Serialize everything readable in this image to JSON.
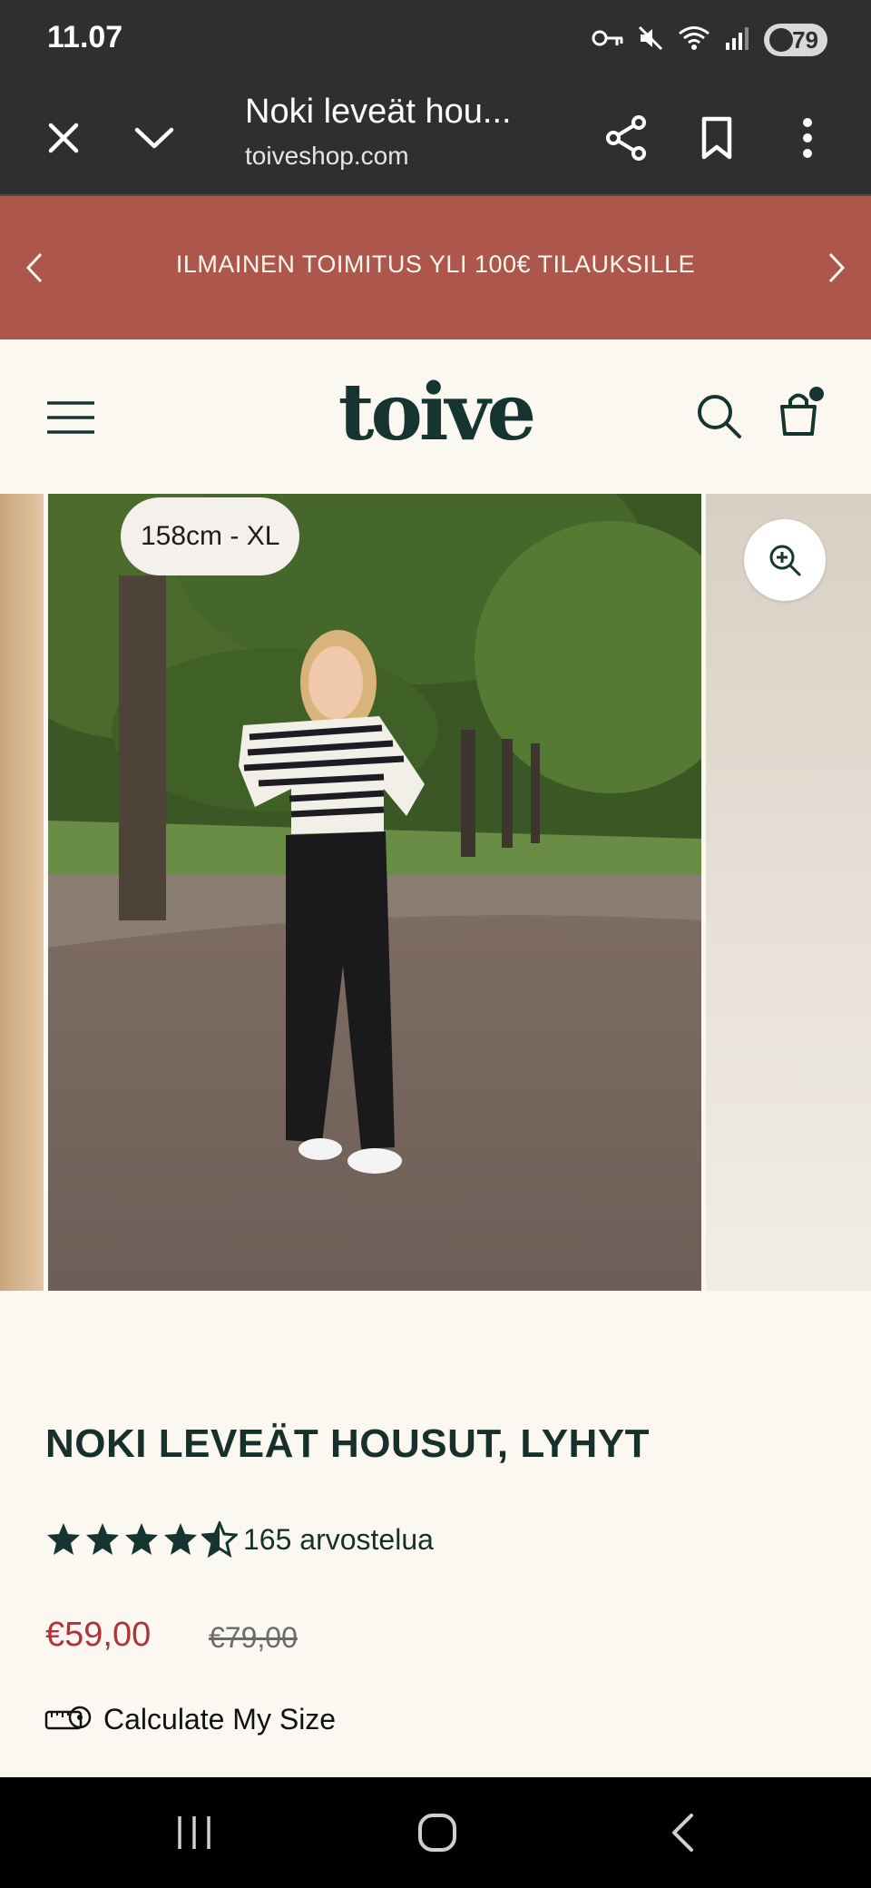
{
  "status_bar": {
    "time": "11.07",
    "battery": "79",
    "icons": [
      "vpn-key-icon",
      "mute-icon",
      "wifi-icon",
      "signal-icon",
      "battery-icon"
    ]
  },
  "browser": {
    "title": "Noki leveät hou...",
    "url": "toiveshop.com",
    "icons": [
      "close-icon",
      "chevron-down-icon",
      "share-icon",
      "bookmark-icon",
      "more-vert-icon"
    ]
  },
  "promo": {
    "text": "ILMAINEN TOIMITUS YLI 100€ TILAUKSILLE",
    "color": "#ac564c"
  },
  "header": {
    "logo": "toive",
    "brand_color": "#163531",
    "icons": [
      "menu-icon",
      "search-icon",
      "cart-icon"
    ]
  },
  "gallery": {
    "size_label": "158cm - XL",
    "zoom_icon": "zoom-in-icon"
  },
  "product": {
    "title": "NOKI LEVEÄT HOUSUT, LYHYT",
    "rating": 4.5,
    "reviews": "165 arvostelua",
    "price": "€59,00",
    "original_price": "€79,00",
    "price_color": "#b1333a",
    "size_link": "Calculate My Size",
    "size_icon": "measuring-tape-icon"
  },
  "navigation": {
    "icons": [
      "recent-apps-icon",
      "home-icon",
      "back-icon"
    ]
  }
}
